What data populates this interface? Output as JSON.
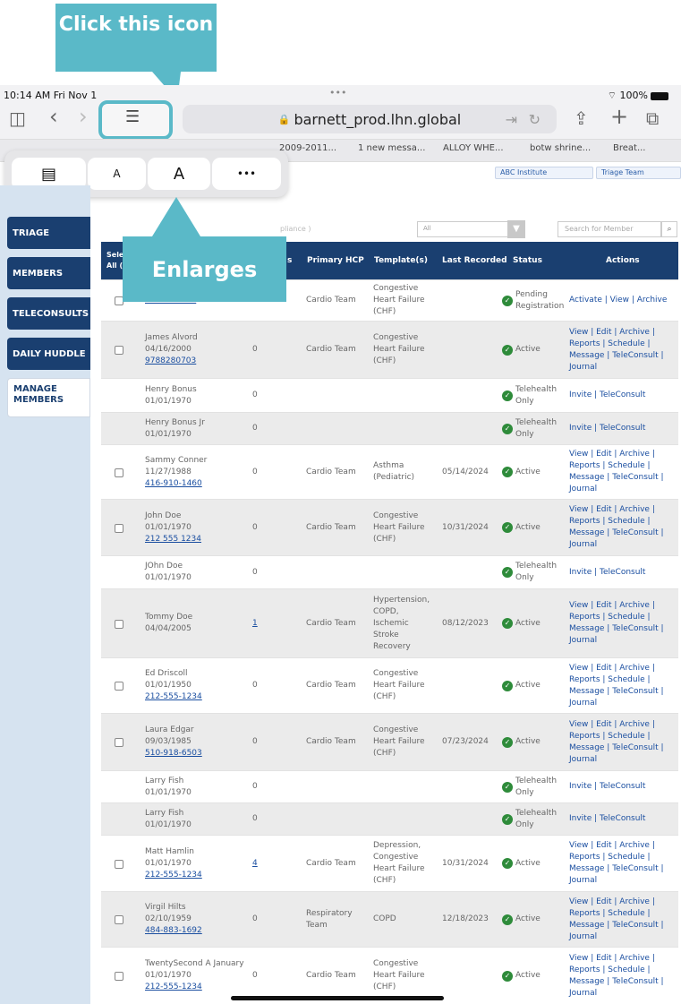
{
  "annotation": {
    "callout_top": "Click this icon",
    "callout_mid": "Enlarges"
  },
  "status_bar": {
    "time": "10:14 AM  Fri Nov 1",
    "dots": "•••",
    "battery": "100%"
  },
  "browser": {
    "url": "barnett_prod.lhn.global",
    "tabs": [
      "2009-2011...",
      "1 new messa...",
      "ALLOY WHE...",
      "botw shrine...",
      "Breat..."
    ],
    "institute_select": "ABC Institute",
    "team_select": "Triage Team"
  },
  "reader_popup": {
    "small_a": "A",
    "large_a": "A",
    "more": "•••"
  },
  "sidebar": {
    "items": [
      "TRIAGE",
      "MEMBERS",
      "TELECONSULTS",
      "DAILY HUDDLE",
      "MANAGE MEMBERS"
    ]
  },
  "controls": {
    "compliance_text": "pliance )",
    "filter_value": "All",
    "search_placeholder": "Search for Member"
  },
  "table": {
    "headers": {
      "select": "Sele All (",
      "readings": "s",
      "hcp": "Primary HCP",
      "templates": "Template(s)",
      "last": "Last Recorded",
      "status": "Status",
      "actions": "Actions"
    },
    "rows": [
      {
        "name": "",
        "dob": "",
        "phone": "9788280703",
        "count": "",
        "hcp": "Cardio Team",
        "template": "Congestive Heart Failure (CHF)",
        "last": "",
        "status": "Pending Registration",
        "actions": "Activate | View | Archive"
      },
      {
        "name": "James Alvord",
        "dob": "04/16/2000",
        "phone": "9788280703",
        "count": "0",
        "hcp": "Cardio Team",
        "template": "Congestive Heart Failure (CHF)",
        "last": "",
        "status": "Active",
        "actions": "View | Edit | Archive | Reports | Schedule | Message | TeleConsult | Journal"
      },
      {
        "name": "Henry Bonus",
        "dob": "01/01/1970",
        "phone": "",
        "count": "0",
        "hcp": "",
        "template": "",
        "last": "",
        "status": "Telehealth Only",
        "actions": "Invite | TeleConsult"
      },
      {
        "name": "Henry Bonus Jr",
        "dob": "01/01/1970",
        "phone": "",
        "count": "0",
        "hcp": "",
        "template": "",
        "last": "",
        "status": "Telehealth Only",
        "actions": "Invite | TeleConsult"
      },
      {
        "name": "Sammy Conner",
        "dob": "11/27/1988",
        "phone": "416-910-1460",
        "count": "0",
        "hcp": "Cardio Team",
        "template": "Asthma (Pediatric)",
        "last": "05/14/2024",
        "status": "Active",
        "actions": "View | Edit | Archive | Reports | Schedule | Message | TeleConsult | Journal"
      },
      {
        "name": "John Doe",
        "dob": "01/01/1970",
        "phone": "212 555 1234",
        "count": "0",
        "hcp": "Cardio Team",
        "template": "Congestive Heart Failure (CHF)",
        "last": "10/31/2024",
        "status": "Active",
        "actions": "View | Edit | Archive | Reports | Schedule | Message | TeleConsult | Journal"
      },
      {
        "name": "JOhn Doe",
        "dob": "01/01/1970",
        "phone": "",
        "count": "0",
        "hcp": "",
        "template": "",
        "last": "",
        "status": "Telehealth Only",
        "actions": "Invite | TeleConsult"
      },
      {
        "name": "Tommy Doe",
        "dob": "04/04/2005",
        "phone": "",
        "count": "1",
        "hcp": "Cardio Team",
        "template": "Hypertension, COPD, Ischemic Stroke Recovery",
        "last": "08/12/2023",
        "status": "Active",
        "actions": "View | Edit | Archive | Reports | Schedule | Message | TeleConsult | Journal"
      },
      {
        "name": "Ed Driscoll",
        "dob": "01/01/1950",
        "phone": "212-555-1234",
        "count": "0",
        "hcp": "Cardio Team",
        "template": "Congestive Heart Failure (CHF)",
        "last": "",
        "status": "Active",
        "actions": "View | Edit | Archive | Reports | Schedule | Message | TeleConsult | Journal"
      },
      {
        "name": "Laura Edgar",
        "dob": "09/03/1985",
        "phone": "510-918-6503",
        "count": "0",
        "hcp": "Cardio Team",
        "template": "Congestive Heart Failure (CHF)",
        "last": "07/23/2024",
        "status": "Active",
        "actions": "View | Edit | Archive | Reports | Schedule | Message | TeleConsult | Journal"
      },
      {
        "name": "Larry Fish",
        "dob": "01/01/1970",
        "phone": "",
        "count": "0",
        "hcp": "",
        "template": "",
        "last": "",
        "status": "Telehealth Only",
        "actions": "Invite | TeleConsult"
      },
      {
        "name": "Larry Fish",
        "dob": "01/01/1970",
        "phone": "",
        "count": "0",
        "hcp": "",
        "template": "",
        "last": "",
        "status": "Telehealth Only",
        "actions": "Invite | TeleConsult"
      },
      {
        "name": "Matt Hamlin",
        "dob": "01/01/1970",
        "phone": "212-555-1234",
        "count": "4",
        "hcp": "Cardio Team",
        "template": "Depression, Congestive Heart Failure (CHF)",
        "last": "10/31/2024",
        "status": "Active",
        "actions": "View | Edit | Archive | Reports | Schedule | Message | TeleConsult | Journal"
      },
      {
        "name": "Virgil Hilts",
        "dob": "02/10/1959",
        "phone": "484-883-1692",
        "count": "0",
        "hcp": "Respiratory Team",
        "template": "COPD",
        "last": "12/18/2023",
        "status": "Active",
        "actions": "View | Edit | Archive | Reports | Schedule | Message | TeleConsult | Journal"
      },
      {
        "name": "TwentySecond A January",
        "dob": "01/01/1970",
        "phone": "212-555-1234",
        "count": "0",
        "hcp": "Cardio Team",
        "template": "Congestive Heart Failure (CHF)",
        "last": "",
        "status": "Active",
        "actions": "View | Edit | Archive | Reports | Schedule | Message | TeleConsult | Journal"
      }
    ]
  }
}
